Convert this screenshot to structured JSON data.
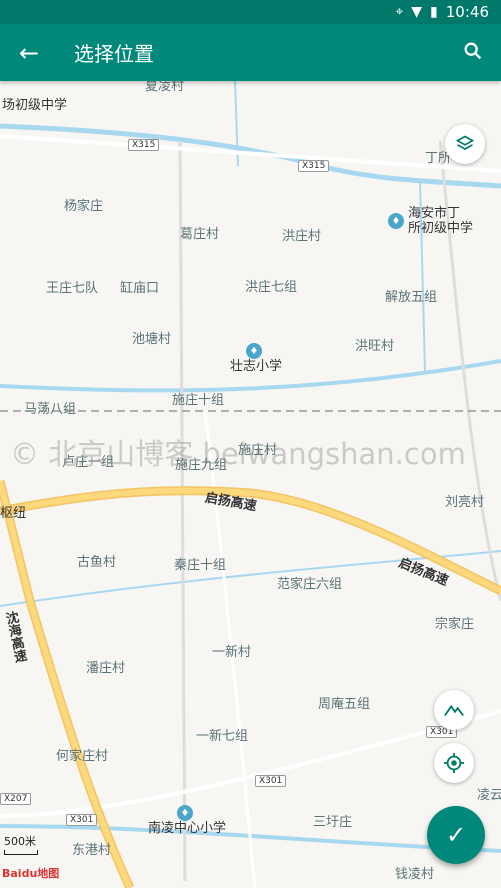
{
  "status_bar": {
    "time": "10:46",
    "icons": [
      "location-icon",
      "wifi-icon",
      "signal-icon",
      "battery-icon"
    ]
  },
  "app_bar": {
    "title": "选择位置",
    "back_icon": "arrow-back-icon",
    "search_icon": "search-icon"
  },
  "map": {
    "places": [
      {
        "id": "p1",
        "text": "场初级中学"
      },
      {
        "id": "p2",
        "text": "杨家庄"
      },
      {
        "id": "p3",
        "text": "葛庄村"
      },
      {
        "id": "p4",
        "text": "洪庄村"
      },
      {
        "id": "p5",
        "text": "王庄七队"
      },
      {
        "id": "p6",
        "text": "缸庙口"
      },
      {
        "id": "p7",
        "text": "洪庄七组"
      },
      {
        "id": "p8",
        "text": "解放五组"
      },
      {
        "id": "p9",
        "text": "池塘村"
      },
      {
        "id": "p10",
        "text": "洪旺村"
      },
      {
        "id": "p11",
        "text": "马荡八组"
      },
      {
        "id": "p12",
        "text": "施庄十组"
      },
      {
        "id": "p13",
        "text": "卢庄一组"
      },
      {
        "id": "p14",
        "text": "施庄九组"
      },
      {
        "id": "p15",
        "text": "施庄村"
      },
      {
        "id": "p16",
        "text": "刘亮村"
      },
      {
        "id": "p17",
        "text": "古鱼村"
      },
      {
        "id": "p18",
        "text": "秦庄十组"
      },
      {
        "id": "p19",
        "text": "范家庄六组"
      },
      {
        "id": "p20",
        "text": "宗家庄"
      },
      {
        "id": "p21",
        "text": "一新村"
      },
      {
        "id": "p22",
        "text": "潘庄村"
      },
      {
        "id": "p23",
        "text": "周庵五组"
      },
      {
        "id": "p24",
        "text": "一新七组"
      },
      {
        "id": "p25",
        "text": "何家庄村"
      },
      {
        "id": "p26",
        "text": "三圩庄"
      },
      {
        "id": "p27",
        "text": "东港村"
      },
      {
        "id": "p28",
        "text": "钱凌村"
      },
      {
        "id": "p29",
        "text": "凌云"
      },
      {
        "id": "p30",
        "text": "丁所"
      },
      {
        "id": "p31",
        "text": "夏凌村"
      },
      {
        "id": "p32",
        "text": "枢纽"
      }
    ],
    "schools": [
      {
        "id": "s1",
        "text": "海安市丁\n所初级中学"
      },
      {
        "id": "s2",
        "text": "壮志小学"
      },
      {
        "id": "s3",
        "text": "南凌中心小学"
      }
    ],
    "roads": [
      {
        "id": "r1",
        "text": "启扬高速"
      },
      {
        "id": "r2",
        "text": "启扬高速"
      },
      {
        "id": "r3",
        "text": "沈海高速"
      }
    ],
    "shields": [
      "X315",
      "X315",
      "X301",
      "X301",
      "X301",
      "X207"
    ],
    "watermark": "© 北京山博客 beiwangshan.com",
    "scale_label": "500米",
    "logo_text": "Baidu地图"
  },
  "controls": {
    "layers_icon": "layers-icon",
    "terrain_icon": "terrain-icon",
    "locate_icon": "my-location-icon",
    "confirm_icon": "check-icon"
  }
}
